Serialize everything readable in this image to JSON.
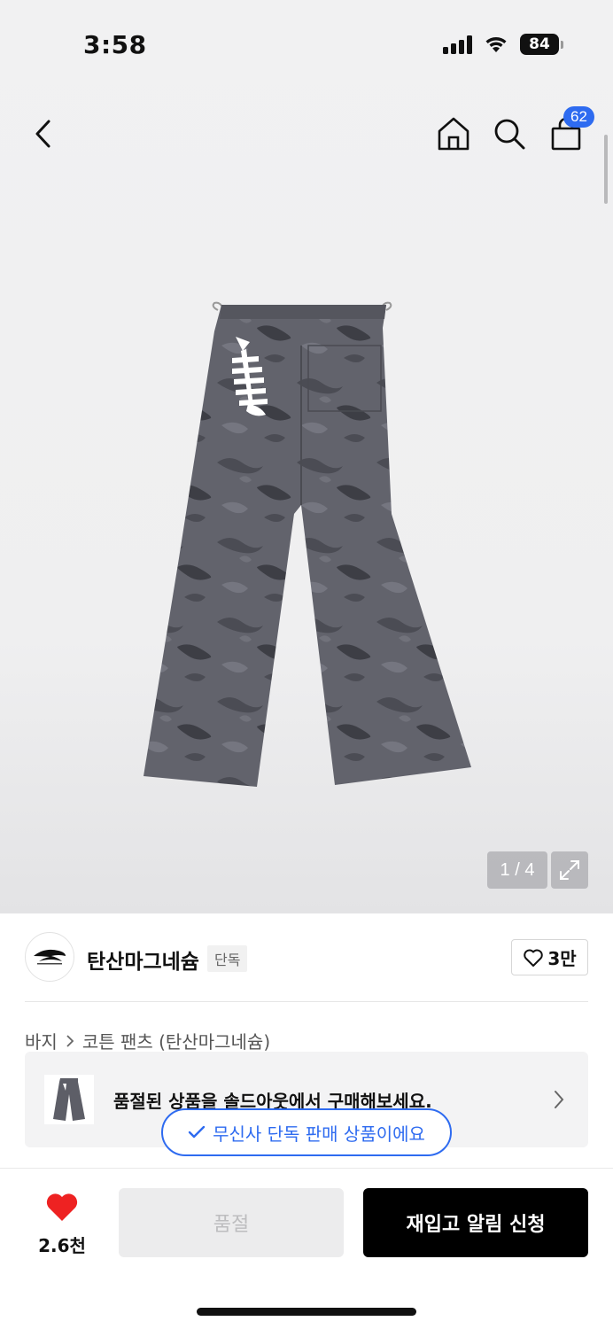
{
  "status_bar": {
    "time": "3:58",
    "battery": "84",
    "icons": [
      "signal-icon",
      "wifi-icon",
      "battery-icon"
    ]
  },
  "nav": {
    "icons": [
      "back-icon",
      "home-icon",
      "search-icon",
      "cart-icon"
    ],
    "cart_count": "62"
  },
  "gallery": {
    "counter": "1 / 4",
    "expand_icon": "expand-icon"
  },
  "brand": {
    "name": "탄산마그네슘",
    "tag": "단독",
    "likes": "3만"
  },
  "breadcrumb": {
    "category": "바지",
    "subcategory": "코튼 팬츠 (탄산마그네슘)"
  },
  "soldout_banner": {
    "text": "품절된 상품을 솔드아웃에서 구매해보세요."
  },
  "exclusive_pill": {
    "text": "무신사 단독 판매 상품이에요"
  },
  "bottom_bar": {
    "wish_count": "2.6천",
    "soldout_label": "품절",
    "restock_label": "재입고 알림 신청",
    "accent_color": "#ee2222"
  },
  "colors": {
    "accent_blue": "#2e6bf0",
    "primary_button": "#000000"
  }
}
